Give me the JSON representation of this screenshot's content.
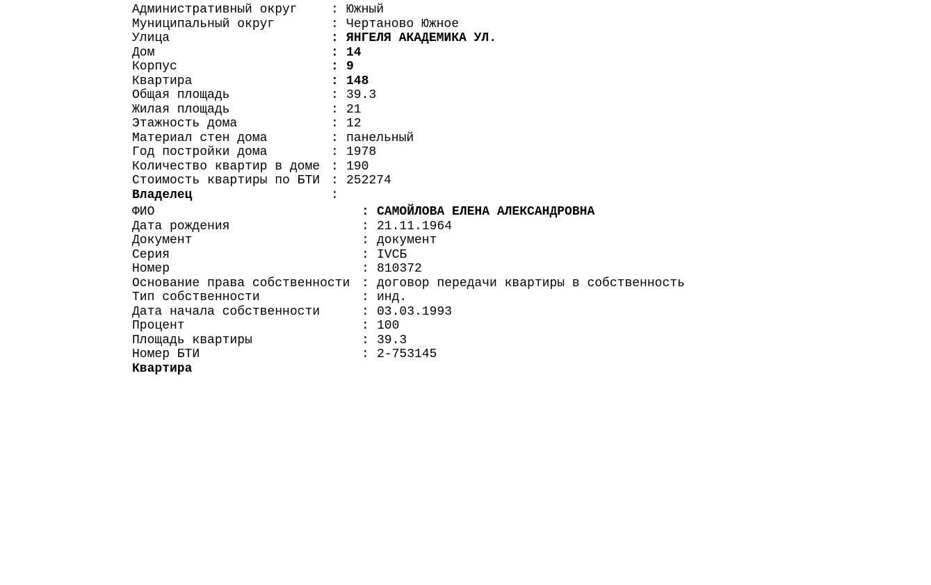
{
  "property": {
    "fields": [
      {
        "label": "Административный округ",
        "value": "Южный",
        "bold": false
      },
      {
        "label": "Муниципальный округ",
        "value": "Чертаново Южное",
        "bold": false
      },
      {
        "label": "Улица",
        "value": "ЯНГЕЛЯ АКАДЕМИКА УЛ.",
        "bold": true
      },
      {
        "label": "Дом",
        "value": "14",
        "bold": true
      },
      {
        "label": "Корпус",
        "value": "9",
        "bold": true
      },
      {
        "label": "Квартира",
        "value": "148",
        "bold": true
      },
      {
        "label": "Общая площадь",
        "value": "39.3",
        "bold": false
      },
      {
        "label": "Жилая площадь",
        "value": "21",
        "bold": false
      },
      {
        "label": "Этажность дома",
        "value": "12",
        "bold": false
      },
      {
        "label": "Материал стен дома",
        "value": "панельный",
        "bold": false
      },
      {
        "label": "Год постройки дома",
        "value": "1978",
        "bold": false
      },
      {
        "label": "Количество квартир в доме",
        "value": "190",
        "bold": false
      },
      {
        "label": "Стоимость квартиры по БТИ",
        "value": "252274",
        "bold": false
      }
    ]
  },
  "owner": {
    "heading": "Владелец",
    "fields": [
      {
        "label": "ФИО",
        "value": "САМОЙЛОВА ЕЛЕНА АЛЕКСАНДРОВНА",
        "bold": true
      },
      {
        "label": "Дата рождения",
        "value": "21.11.1964",
        "bold": false
      },
      {
        "label": "Документ",
        "value": "документ",
        "bold": false
      },
      {
        "label": "Серия",
        "value": "IVСБ",
        "bold": false
      },
      {
        "label": "Номер",
        "value": "810372",
        "bold": false
      },
      {
        "label": "Основание права собственности",
        "value": "договор передачи квартиры в собственность",
        "bold": false
      },
      {
        "label": "Тип собственности",
        "value": "инд.",
        "bold": false
      },
      {
        "label": "Дата начала собственности",
        "value": "03.03.1993",
        "bold": false
      },
      {
        "label": "Процент",
        "value": "100",
        "bold": false
      },
      {
        "label": "Площадь квартиры",
        "value": "39.3",
        "bold": false
      },
      {
        "label": "Номер БТИ",
        "value": "2-753145",
        "bold": false
      }
    ]
  },
  "footer": {
    "heading": "Квартира"
  },
  "separator": ":"
}
